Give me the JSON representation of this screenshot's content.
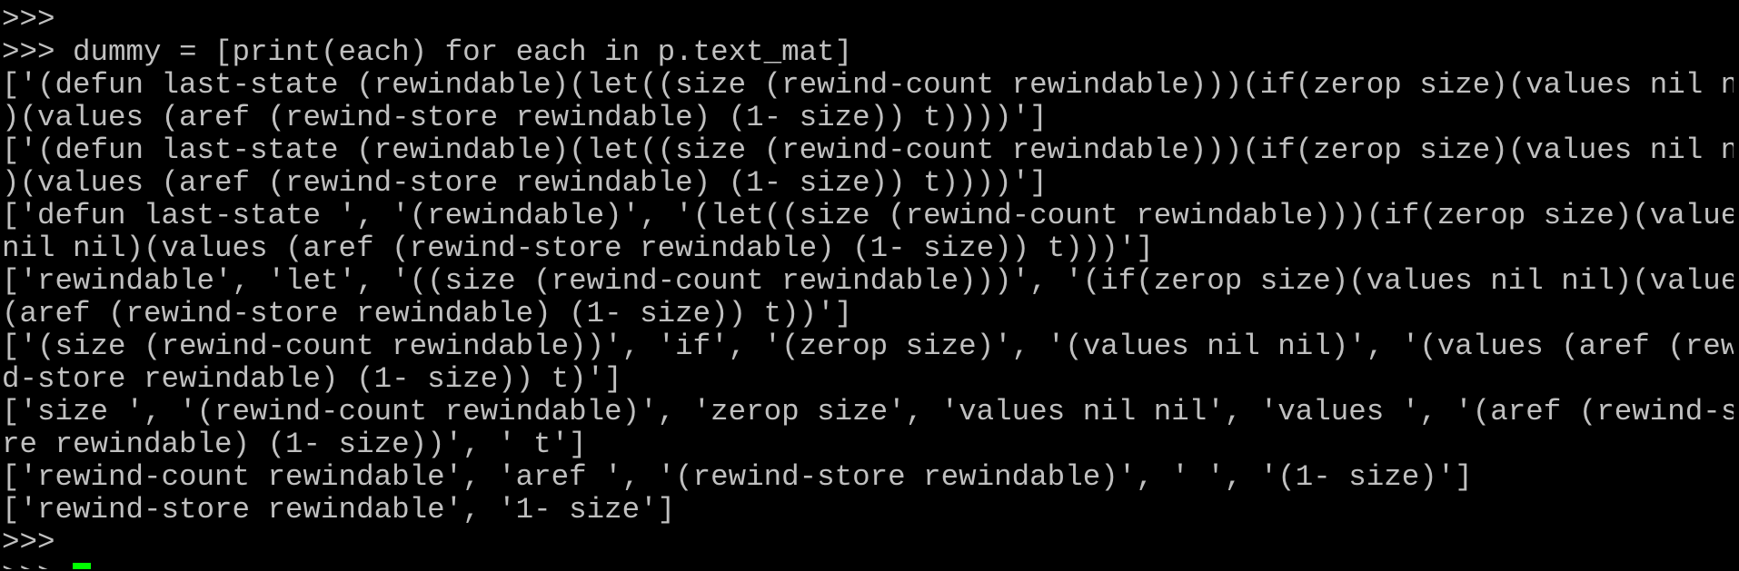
{
  "terminal": {
    "lines": [
      ">>>",
      ">>> dummy = [print(each) for each in p.text_mat]",
      "['(defun last-state (rewindable)(let((size (rewind-count rewindable)))(if(zerop size)(values nil nil",
      ")(values (aref (rewind-store rewindable) (1- size)) t))))']",
      "['(defun last-state (rewindable)(let((size (rewind-count rewindable)))(if(zerop size)(values nil nil",
      ")(values (aref (rewind-store rewindable) (1- size)) t))))']",
      "['defun last-state ', '(rewindable)', '(let((size (rewind-count rewindable)))(if(zerop size)(values",
      "nil nil)(values (aref (rewind-store rewindable) (1- size)) t)))']",
      "['rewindable', 'let', '((size (rewind-count rewindable)))', '(if(zerop size)(values nil nil)(values",
      "(aref (rewind-store rewindable) (1- size)) t))']",
      "['(size (rewind-count rewindable))', 'if', '(zerop size)', '(values nil nil)', '(values (aref (rewin",
      "d-store rewindable) (1- size)) t)']",
      "['size ', '(rewind-count rewindable)', 'zerop size', 'values nil nil', 'values ', '(aref (rewind-sto",
      "re rewindable) (1- size))', ' t']",
      "['rewind-count rewindable', 'aref ', '(rewind-store rewindable)', ' ', '(1- size)']",
      "['rewind-store rewindable', '1- size']",
      ">>>"
    ],
    "prompt": ">>> ",
    "colors": {
      "background": "#000000",
      "text": "#c0c0c0",
      "cursor": "#00ff00"
    }
  }
}
